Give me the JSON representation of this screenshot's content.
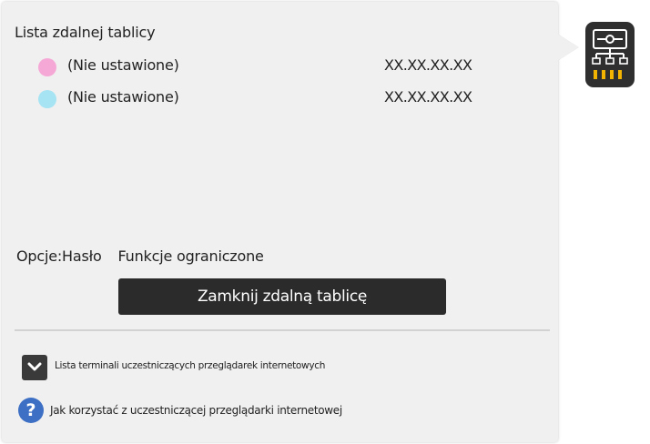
{
  "panel": {
    "title": "Lista zdalnej tablicy",
    "boards": [
      {
        "name": "(Nie ustawione)",
        "ip": "XX.XX.XX.XX",
        "color": "#f5a8d6"
      },
      {
        "name": "(Nie ustawione)",
        "ip": "XX.XX.XX.XX",
        "color": "#a6e3f3"
      }
    ],
    "options": {
      "label": "Opcje:Hasło",
      "value": "Funkcje ograniczone"
    },
    "close_button_label": "Zamknij zdalną tablicę",
    "participants_toggle_label": "Lista terminali uczestniczących przeglądarek internetowych",
    "help_label": "Jak korzystać z uczestniczącej przeglądarki internetowej",
    "help_glyph": "?"
  },
  "icons": {
    "expand": "chevron-down-icon",
    "help": "question-icon",
    "app": "remote-board-network-icon"
  },
  "colors": {
    "panel_bg": "#f0f0f0",
    "button_bg": "#2b2b2b",
    "help_blue": "#3d6fc4",
    "app_accent": "#f2b400"
  }
}
